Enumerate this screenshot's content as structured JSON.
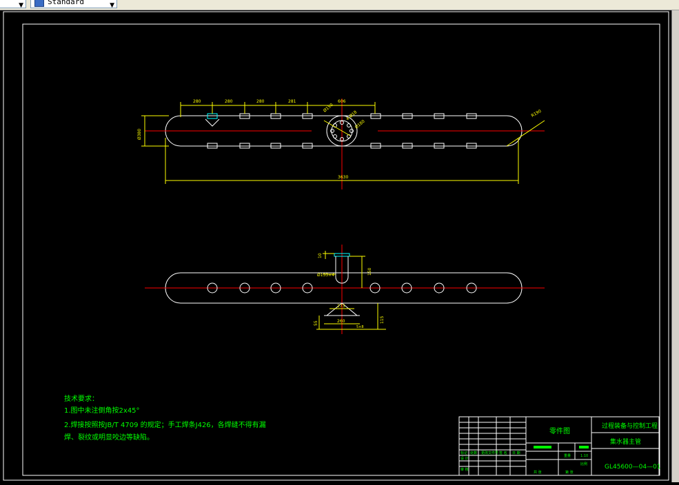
{
  "toolbar": {
    "left_dropdown_value": "",
    "style_dropdown_value": "Standard"
  },
  "drawing": {
    "top_view_dims": {
      "d1": "280",
      "d2": "280",
      "d3": "280",
      "d4": "281",
      "d5": "606",
      "overall_length": "3630",
      "left_vertical": "Ø380",
      "flange_dia": "Ø150",
      "hole_label": "4-Ø18",
      "bolt_circle": "Ø180",
      "end_radius": "R190"
    },
    "front_view_dims": {
      "pipe_h": "10",
      "nozzle_label": "Ø133×4",
      "nozzle_h": "150",
      "saddle_w1": "273",
      "saddle_w2": "260",
      "left_h": "55",
      "right_h": "115",
      "small_label": "5×8"
    },
    "tech_req": {
      "title": "技术要求：",
      "line1": "1.图中未注倒角按2x45°",
      "line2": "2.焊接按照按JB/T 4709 的规定；手工焊条J426，各焊缝不得有漏",
      "line3": "焊、裂纹或明显咬边等缺陷。"
    },
    "title_block": {
      "drawing_type": "零件图",
      "company": "过程装备与控制工程",
      "part_name": "集水器主管",
      "drawing_no": "GL45600—04—01",
      "scale": "1:10",
      "small1": "标记",
      "small2": "处数",
      "small3": "更改文件号",
      "small4": "签 名",
      "small5": "日 期",
      "small6": "设 计",
      "small7": "审 核",
      "small8": "共 张",
      "small9": "第 张",
      "small10": "重量",
      "small11": "比例"
    }
  }
}
